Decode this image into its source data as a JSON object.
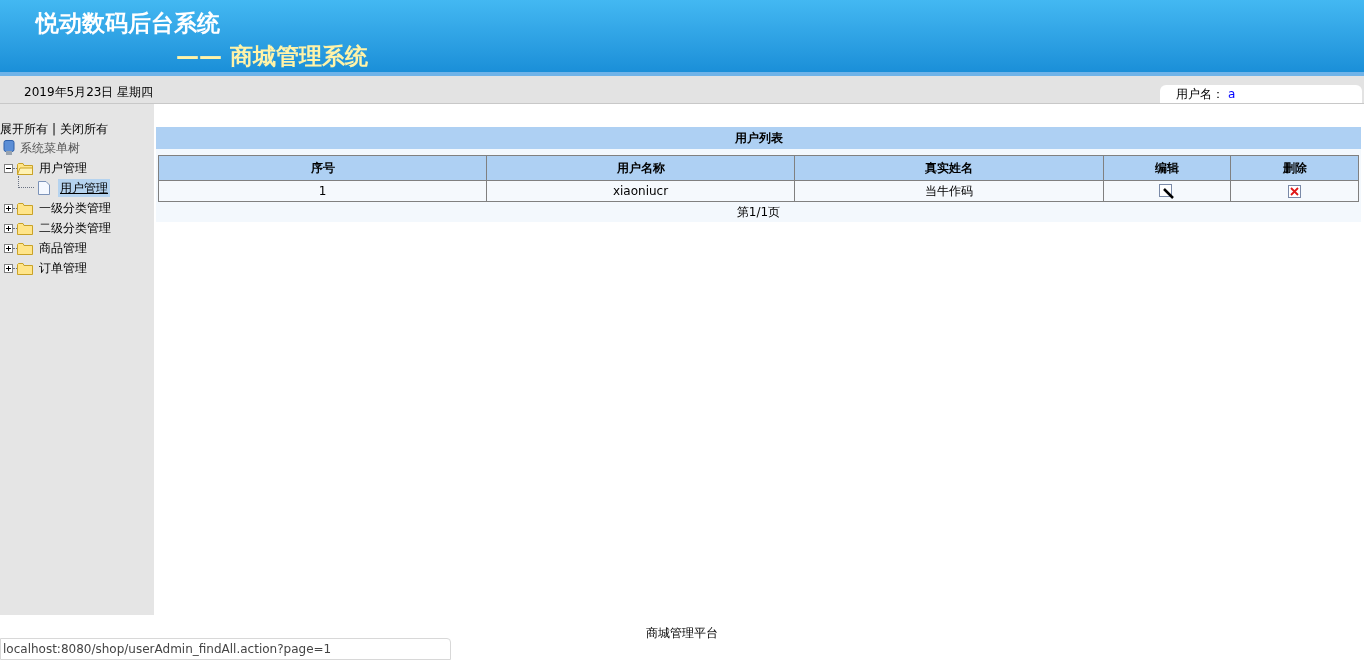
{
  "header": {
    "title": "悦动数码后台系统",
    "subtitle": "—— 商城管理系统"
  },
  "info_bar": {
    "date": "2019年5月23日 星期四",
    "user_label": "用户名：",
    "user_value": "a"
  },
  "sidebar": {
    "expand_all": "展开所有",
    "separator": "|",
    "collapse_all": "关闭所有",
    "tree": {
      "label": "系统菜单树",
      "children": [
        {
          "label": "用户管理",
          "expanded": true,
          "selected": false,
          "children": [
            {
              "label": "用户管理",
              "selected": true
            }
          ]
        },
        {
          "label": "一级分类管理",
          "expanded": false,
          "selected": false
        },
        {
          "label": "二级分类管理",
          "expanded": false,
          "selected": false
        },
        {
          "label": "商品管理",
          "expanded": false,
          "selected": false
        },
        {
          "label": "订单管理",
          "expanded": false,
          "selected": false
        }
      ]
    }
  },
  "table": {
    "title": "用户列表",
    "columns": [
      "序号",
      "用户名称",
      "真实姓名",
      "编辑",
      "删除"
    ],
    "rows": [
      {
        "index": "1",
        "username": "xiaoniucr",
        "real_name": "当牛作码"
      }
    ],
    "pagination": "第1/1页"
  },
  "footer": "商城管理平台",
  "status_bar": "localhost:8080/shop/userAdmin_findAll.action?page=1"
}
